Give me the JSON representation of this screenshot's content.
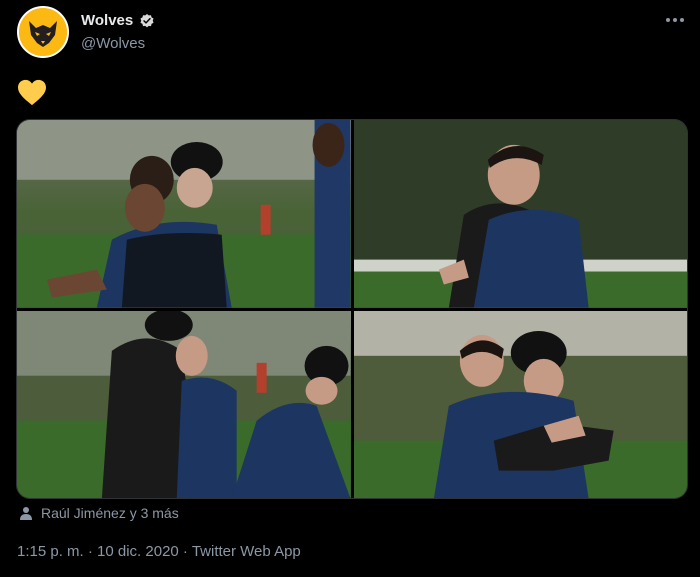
{
  "tweet": {
    "display_name": "Wolves",
    "handle": "@Wolves",
    "body_emoji": "yellow-heart",
    "tagged_people": "Raúl Jiménez y 3 más",
    "timestamp": "1:15 p. m. · 10 dic. 2020 · Twitter Web App"
  },
  "colors": {
    "background": "#000000",
    "text_primary": "#e7e9ea",
    "text_secondary": "#8b98a5",
    "brand_gold": "#fdb913",
    "heart": "#ffcc4d"
  },
  "media": {
    "count": 4,
    "photos": [
      {
        "subject": "players-embracing-1"
      },
      {
        "subject": "players-embracing-2"
      },
      {
        "subject": "players-embracing-3"
      },
      {
        "subject": "players-embracing-4"
      }
    ]
  }
}
